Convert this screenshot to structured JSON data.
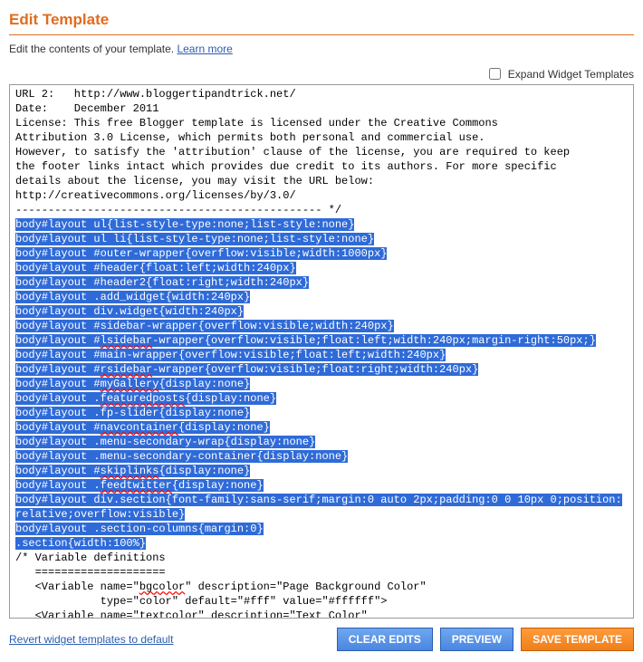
{
  "header": {
    "title": "Edit Template",
    "instructions": "Edit the contents of your template. ",
    "learn_more": "Learn more"
  },
  "expand": {
    "label": "Expand Widget Templates",
    "checked": false
  },
  "editor": {
    "plain_lines_top": [
      "URL 2:   http://www.bloggertipandtrick.net/",
      "Date:    December 2011",
      "License: This free Blogger template is licensed under the Creative Commons",
      "Attribution 3.0 License, which permits both personal and commercial use.",
      "However, to satisfy the 'attribution' clause of the license, you are required to keep",
      "the footer links intact which provides due credit to its authors. For more specific",
      "details about the license, you may visit the URL below:",
      "http://creativecommons.org/licenses/by/3.0/",
      "----------------------------------------------- */",
      ""
    ],
    "highlighted_lines": [
      "body#layout ul{list-style-type:none;list-style:none}",
      "body#layout ul li{list-style-type:none;list-style:none}",
      "body#layout #outer-wrapper{overflow:visible;width:1000px}",
      "body#layout #header{float:left;width:240px}",
      "body#layout #header2{float:right;width:240px}",
      "body#layout .add_widget{width:240px}",
      "body#layout div.widget{width:240px}",
      "body#layout #sidebar-wrapper{overflow:visible;width:240px}",
      "body#layout #lsidebar-wrapper{overflow:visible;float:left;width:240px;margin-right:50px;}",
      "body#layout #main-wrapper{overflow:visible;float:left;width:240px}",
      "body#layout #rsidebar-wrapper{overflow:visible;float:right;width:240px}",
      "body#layout #myGallery{display:none}",
      "body#layout .featuredposts{display:none}",
      "body#layout .fp-slider{display:none}",
      "body#layout #navcontainer{display:none}",
      "body#layout .menu-secondary-wrap{display:none}",
      "body#layout .menu-secondary-container{display:none}",
      "body#layout #skiplinks{display:none}",
      "body#layout .feedtwitter{display:none}",
      "body#layout div.section{font-family:sans-serif;margin:0 auto 2px;padding:0 0 10px 0;position:relative;overflow:visible}",
      "body#layout .section-columns{margin:0}",
      ".section{width:100%}"
    ],
    "plain_lines_bottom": [
      "",
      "/* Variable definitions",
      "   ====================",
      "   <Variable name=\"bgcolor\" description=\"Page Background Color\"",
      "             type=\"color\" default=\"#fff\" value=\"#ffffff\">",
      "   <Variable name=\"textcolor\" description=\"Text Color\""
    ]
  },
  "footer": {
    "revert_link": "Revert widget templates to default",
    "clear_edits": "CLEAR EDITS",
    "preview": "PREVIEW",
    "save": "SAVE TEMPLATE"
  }
}
